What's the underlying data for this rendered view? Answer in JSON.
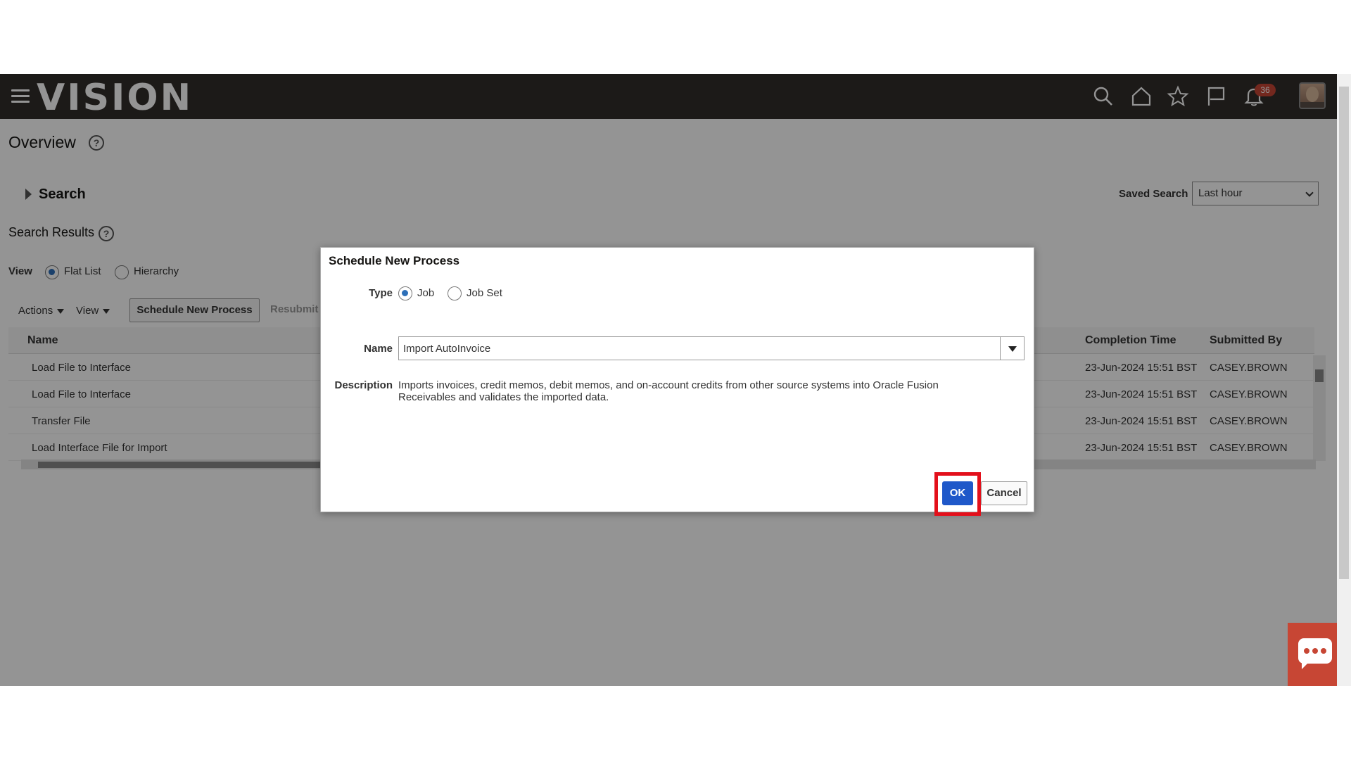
{
  "header": {
    "logo": "VISION",
    "notification_count": "36"
  },
  "page": {
    "title": "Overview",
    "search_label": "Search",
    "saved_search_label": "Saved Search",
    "saved_search_value": "Last hour",
    "results_title": "Search Results",
    "view_label": "View",
    "view_options": [
      "Flat List",
      "Hierarchy"
    ],
    "toolbar": {
      "actions": "Actions",
      "view": "View",
      "schedule": "Schedule New Process",
      "resubmit": "Resubmit"
    },
    "table": {
      "columns": [
        "Name",
        "Completion Time",
        "Submitted By"
      ],
      "rows": [
        {
          "name": "Load File to Interface",
          "completion": "23-Jun-2024 15:51 BST",
          "submitted": "CASEY.BROWN"
        },
        {
          "name": "Load File to Interface",
          "completion": "23-Jun-2024 15:51 BST",
          "submitted": "CASEY.BROWN"
        },
        {
          "name": "Transfer File",
          "completion": "23-Jun-2024 15:51 BST",
          "submitted": "CASEY.BROWN"
        },
        {
          "name": "Load Interface File for Import",
          "completion": "23-Jun-2024 15:51 BST",
          "submitted": "CASEY.BROWN"
        }
      ]
    }
  },
  "dialog": {
    "title": "Schedule New Process",
    "type_label": "Type",
    "type_options": [
      "Job",
      "Job Set"
    ],
    "name_label": "Name",
    "name_value": "Import AutoInvoice",
    "description_label": "Description",
    "description": "Imports invoices, credit memos, debit memos, and on-account credits from other source systems into Oracle Fusion Receivables and validates the imported data.",
    "ok": "OK",
    "cancel": "Cancel"
  },
  "colors": {
    "header_bg": "#312d2a",
    "ok_button": "#1f58c9",
    "highlight": "#e3101b",
    "chat_button": "#c74634"
  }
}
